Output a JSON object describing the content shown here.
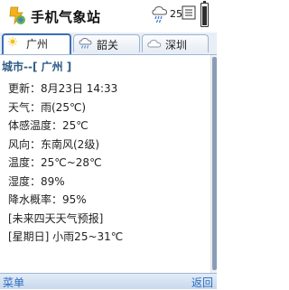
{
  "app": {
    "title": "手机气象站",
    "status_number": "25"
  },
  "tabs": [
    {
      "label": "广州",
      "icon": "sun-icon",
      "active": true
    },
    {
      "label": "韶关",
      "icon": "rain-cloud-icon",
      "active": false
    },
    {
      "label": "深圳",
      "icon": "cloud-icon",
      "active": false
    }
  ],
  "content": {
    "city_heading": "城市--[ 广州 ]",
    "rows": [
      "更新：8月23日 14:33",
      "天气：雨(25℃)",
      "体感温度：25℃",
      "风向：东南风(2级)",
      "温度：25℃~28℃",
      "湿度：89%",
      "降水概率：95%",
      "[未来四天天气预报]",
      "[星期日] 小雨25~31℃"
    ]
  },
  "softkeys": {
    "left": "菜单",
    "right": "返回"
  },
  "colors": {
    "accent": "#3e6fb5",
    "heading": "#2f5b86",
    "softkey": "#2a6dc2"
  }
}
